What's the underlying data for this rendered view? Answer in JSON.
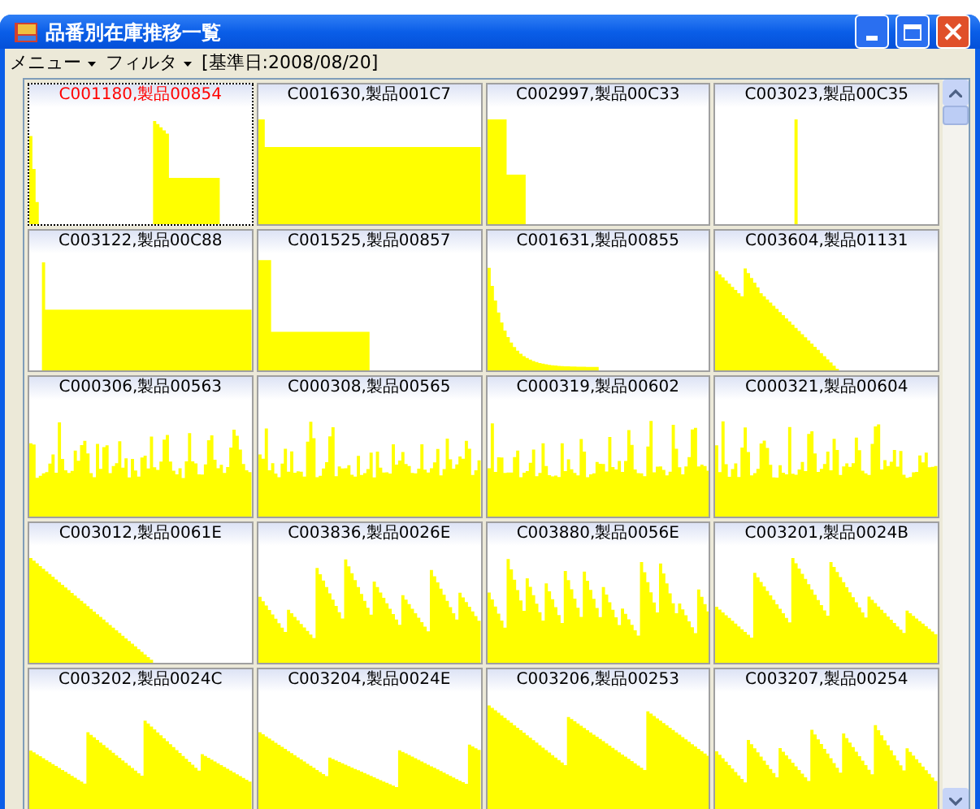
{
  "window": {
    "title": "品番別在庫推移一覧"
  },
  "menu": [
    {
      "label": "メニュー",
      "kind": "dropdown"
    },
    {
      "label": "フィルタ",
      "kind": "dropdown"
    },
    {
      "label": "[基準日:2008/08/20]",
      "kind": "text"
    }
  ],
  "cells": [
    {
      "title": "C001180,製品00854",
      "selected": true
    },
    {
      "title": "C001630,製品001C7",
      "selected": false
    },
    {
      "title": "C002997,製品00C33",
      "selected": false
    },
    {
      "title": "C003023,製品00C35",
      "selected": false
    },
    {
      "title": "C003122,製品00C88",
      "selected": false
    },
    {
      "title": "C001525,製品00857",
      "selected": false
    },
    {
      "title": "C001631,製品00855",
      "selected": false
    },
    {
      "title": "C003604,製品01131",
      "selected": false
    },
    {
      "title": "C000306,製品00563",
      "selected": false
    },
    {
      "title": "C000308,製品00565",
      "selected": false
    },
    {
      "title": "C000319,製品00602",
      "selected": false
    },
    {
      "title": "C000321,製品00604",
      "selected": false
    },
    {
      "title": "C003012,製品0061E",
      "selected": false
    },
    {
      "title": "C003836,製品0026E",
      "selected": false
    },
    {
      "title": "C003880,製品0056E",
      "selected": false
    },
    {
      "title": "C003201,製品0024B",
      "selected": false
    },
    {
      "title": "C003202,製品0024C",
      "selected": false
    },
    {
      "title": "C003204,製品0024E",
      "selected": false
    },
    {
      "title": "C003206,製品00253",
      "selected": false
    },
    {
      "title": "C003207,製品00254",
      "selected": false
    }
  ]
}
